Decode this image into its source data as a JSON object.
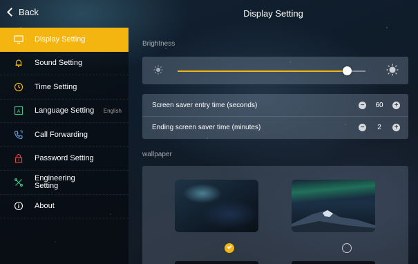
{
  "header": {
    "back_label": "Back",
    "title": "Display Setting"
  },
  "sidebar": {
    "items": [
      {
        "label": "Display Setting",
        "icon": "monitor-icon",
        "active": true,
        "suffix": ""
      },
      {
        "label": "Sound Setting",
        "icon": "bell-icon",
        "active": false,
        "suffix": ""
      },
      {
        "label": "Time Setting",
        "icon": "clock-icon",
        "active": false,
        "suffix": ""
      },
      {
        "label": "Language Setting",
        "icon": "language-icon",
        "active": false,
        "suffix": "English"
      },
      {
        "label": "Call Forwarding",
        "icon": "phone-forward-icon",
        "active": false,
        "suffix": ""
      },
      {
        "label": "Password Setting",
        "icon": "lock-icon",
        "active": false,
        "suffix": ""
      },
      {
        "label": "Engineering Setting",
        "icon": "tools-icon",
        "active": false,
        "suffix": ""
      },
      {
        "label": "About",
        "icon": "info-icon",
        "active": false,
        "suffix": ""
      }
    ]
  },
  "brightness": {
    "label": "Brightness",
    "level_fraction": 0.9
  },
  "screensaver": {
    "entry_label": "Screen saver entry time (seconds)",
    "entry_value": "60",
    "ending_label": "Ending screen saver time (minutes)",
    "ending_value": "2"
  },
  "wallpaper": {
    "label": "wallpaper",
    "options": [
      {
        "name": "nebula",
        "selected": true
      },
      {
        "name": "aurora-mountain",
        "selected": false
      }
    ]
  },
  "colors": {
    "accent": "#f5b510"
  }
}
